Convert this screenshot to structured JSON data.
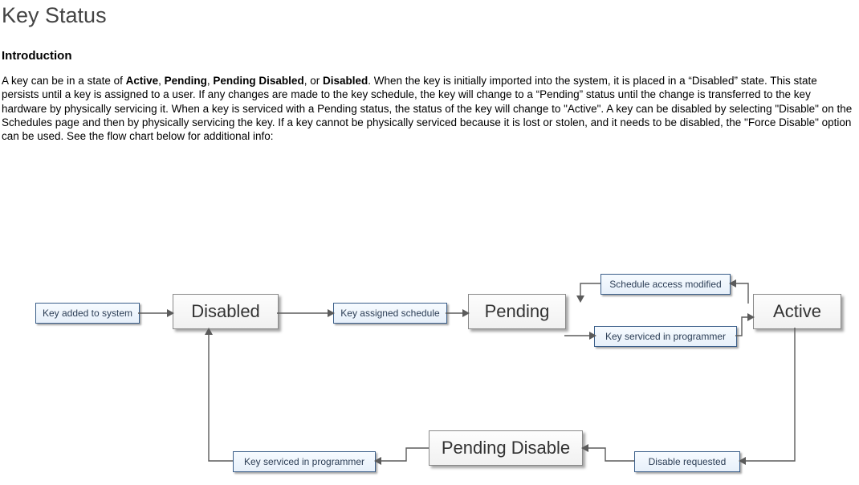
{
  "title": "Key Status",
  "introduction_heading": "Introduction",
  "intro": {
    "p1a": "A key can be in a state of ",
    "s1": "Active",
    "c1": ", ",
    "s2": "Pending",
    "c2": ", ",
    "s3": "Pending Disabled",
    "c3": ", or ",
    "s4": "Disabled",
    "p1b": ".  When the key is initially imported into the system, it is placed in a “Disabled” state.  This state persists until a key is assigned to a user.  If any changes are made to the key schedule, the key will change to a “Pending” status until the change is transferred to the key hardware by physically servicing it. When a key is serviced with a Pending status, the status of the key will change to \"Active\".  A key can be disabled by selecting \"Disable\" on the Schedules page and then by physically servicing the key.  If a key cannot be physically serviced because it is lost or stolen, and it needs to be disabled, the \"Force Disable\" option can be used.  See the flow chart below for additional info:"
  },
  "states": {
    "disabled": "Disabled",
    "pending": "Pending",
    "pending_disable": "Pending Disable",
    "active": "Active"
  },
  "labels": {
    "key_added": "Key added to system",
    "key_assigned": "Key assigned schedule",
    "schedule_modified": "Schedule access modified",
    "key_serviced_top": "Key serviced in programmer",
    "key_serviced_bottom": "Key serviced in programmer",
    "disable_requested": "Disable requested"
  }
}
